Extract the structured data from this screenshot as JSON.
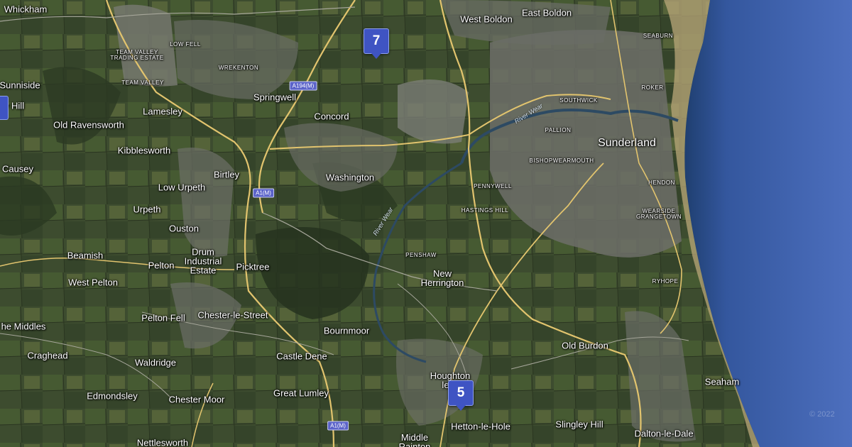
{
  "map": {
    "labels": {
      "whickham": "Whickham",
      "sunniside": "Sunniside",
      "hill": "y Hill",
      "causey": "Causey",
      "the_middles": "he Middles",
      "craghead": "Craghead",
      "edmondsley": "Edmondsley",
      "nettlesworth": "Nettlesworth",
      "team_valley_trading_estate": "TEAM VALLEY\nTRADING ESTATE",
      "low_fell": "LOW FELL",
      "team_valley": "TEAM VALLEY",
      "wrekenton": "WREKENTON",
      "lamesley": "Lamesley",
      "old_ravensworth": "Old Ravensworth",
      "kibblesworth": "Kibblesworth",
      "birtley": "Birtley",
      "low_urpeth": "Low Urpeth",
      "urpeth": "Urpeth",
      "ouston": "Ouston",
      "beamish": "Beamish",
      "pelton": "Pelton",
      "drum_industrial_estate": "Drum\nIndustrial\nEstate",
      "picktree": "Picktree",
      "west_pelton": "West Pelton",
      "pelton_fell": "Pelton Fell",
      "chester_le_street": "Chester-le-Street",
      "waldridge": "Waldridge",
      "chester_moor": "Chester Moor",
      "springwell": "Springwell",
      "concord": "Concord",
      "washington": "Washington",
      "bournmoor": "Bournmoor",
      "castle_dene": "Castle Dene",
      "great_lumley": "Great Lumley",
      "west_boldon": "West Boldon",
      "east_boldon": "East Boldon",
      "pennywell": "PENNYWELL",
      "hastings_hill": "HASTINGS HILL",
      "penshaw": "PENSHAW",
      "new_herrington": "New\nHerrington",
      "houghton_le_spring": "Houghton\nle-S",
      "hetton_le_hole": "Hetton-le-Hole",
      "middle": "Middle\nRainton",
      "seaburn": "SEABURN",
      "roker": "ROKER",
      "southwick": "SOUTHWICK",
      "pallion": "PALLION",
      "sunderland": "Sunderland",
      "bishopwearmouth": "BISHOPWEARMOUTH",
      "hendon": "HENDON",
      "wearside_grangetown": "WEARSIDE\nGRANGETOWN",
      "ryhope": "RYHOPE",
      "old_burdon": "Old Burdon",
      "slingley_hill": "Slingley Hill",
      "dalton_le_dale": "Dalton-le-Dale",
      "seaham": "Seaham"
    },
    "roads": {
      "a194m": "A194(M)",
      "a1m_north": "A1(M)",
      "a1m_south": "A1(M)"
    },
    "rivers": {
      "river_wear_north": "River Wear",
      "river_wear_south": "River Wear"
    },
    "markers": {
      "marker_7": "7",
      "marker_5": "5"
    },
    "attribution": "© 2022",
    "icon_names": [
      "map-pin-icon"
    ],
    "colors": {
      "land": "#3a4a2e",
      "urban": "#6b6e66",
      "sea": "#3b5fa6",
      "marker": "#3f54c3",
      "road_major": "#e2c46e",
      "road_minor": "#a6a69a"
    }
  }
}
